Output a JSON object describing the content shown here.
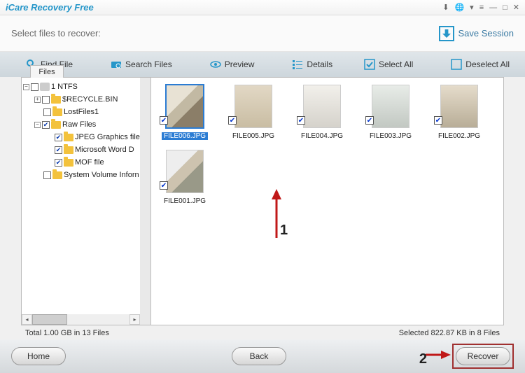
{
  "app": {
    "title": "iCare Recovery Free"
  },
  "header": {
    "prompt": "Select files to recover:",
    "save_session": "Save Session"
  },
  "toolbar": {
    "find": "Find File",
    "search": "Search Files",
    "preview": "Preview",
    "details": "Details",
    "select_all": "Select All",
    "deselect_all": "Deselect All"
  },
  "tab": {
    "files": "Files"
  },
  "tree": {
    "root": "1 NTFS",
    "items": [
      {
        "label": "$RECYCLE.BIN",
        "checked": false,
        "expand": "+"
      },
      {
        "label": "LostFiles1",
        "checked": false,
        "expand": ""
      },
      {
        "label": "Raw Files",
        "checked": true,
        "expand": "-"
      },
      {
        "label": "JPEG Graphics file",
        "checked": true,
        "expand": "",
        "level": 3
      },
      {
        "label": "Microsoft Word D",
        "checked": true,
        "expand": "",
        "level": 3
      },
      {
        "label": "MOF file",
        "checked": true,
        "expand": "",
        "level": 3
      },
      {
        "label": "System Volume Inforn",
        "checked": false,
        "expand": ""
      }
    ]
  },
  "thumbs": [
    {
      "name": "FILE006.JPG",
      "checked": true,
      "selected": true
    },
    {
      "name": "FILE005.JPG",
      "checked": true,
      "selected": false
    },
    {
      "name": "FILE004.JPG",
      "checked": true,
      "selected": false
    },
    {
      "name": "FILE003.JPG",
      "checked": true,
      "selected": false
    },
    {
      "name": "FILE002.JPG",
      "checked": true,
      "selected": false
    },
    {
      "name": "FILE001.JPG",
      "checked": true,
      "selected": false
    }
  ],
  "status": {
    "left": "Total 1.00 GB in 13 Files",
    "right": "Selected 822.87 KB in 8 Files"
  },
  "footer": {
    "home": "Home",
    "back": "Back",
    "recover": "Recover"
  },
  "annot": {
    "n1": "1",
    "n2": "2"
  }
}
